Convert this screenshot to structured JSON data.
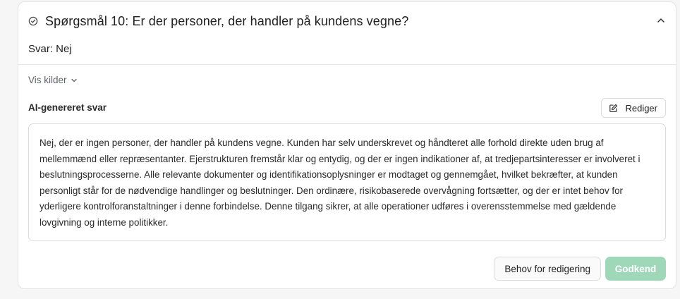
{
  "question": {
    "title": "Spørgsmål 10: Er der personer, der handler på kundens vegne?",
    "answer": "Svar: Nej"
  },
  "sources": {
    "label": "Vis kilder"
  },
  "ai_section": {
    "label": "AI-genereret svar",
    "edit_label": "Rediger",
    "text": "Nej, der er ingen personer, der handler på kundens vegne. Kunden har selv underskrevet og håndteret alle forhold direkte uden brug af mellemmænd eller repræsentanter. Ejerstrukturen fremstår klar og entydig, og der er ingen indikationer af, at tredjepartsinteresser er involveret i beslutningsprocesserne. Alle relevante dokumenter og identifikationsoplysninger er modtaget og gennemgået, hvilket bekræfter, at kunden personligt står for de nødvendige handlinger og beslutninger. Den ordinære, risikobaserede overvågning fortsætter, og der er intet behov for yderligere kontrolforanstaltninger i denne forbindelse. Denne tilgang sikrer, at alle operationer udføres i overensstemmelse med gældende lovgivning og interne politikker."
  },
  "actions": {
    "needs_edit_label": "Behov for redigering",
    "approve_label": "Godkend"
  },
  "icons": {
    "status": "check-circle-icon",
    "collapse": "chevron-up-icon",
    "sources": "chevron-down-icon",
    "edit": "pencil-square-icon"
  },
  "colors": {
    "approve_button": "#9fd8b9",
    "card_background": "#ffffff",
    "page_background": "#f6f6f7"
  }
}
